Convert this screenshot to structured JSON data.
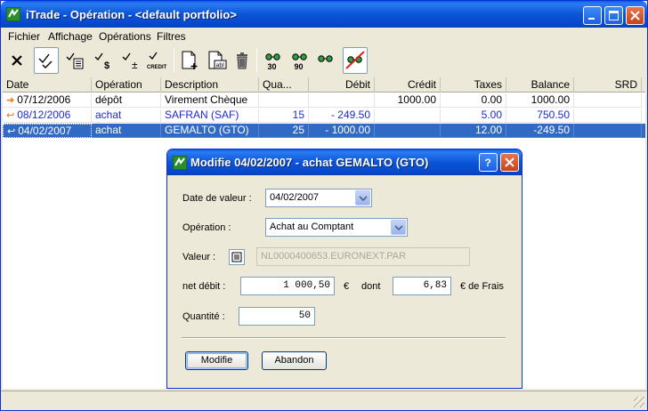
{
  "window": {
    "title": "iTrade - Opération - <default portfolio>"
  },
  "menu": [
    "Fichier",
    "Affichage",
    "Opérations",
    "Filtres"
  ],
  "toolbar": {
    "tools": [
      "close-filter-icon",
      "check-icon",
      "check-list-icon",
      "check-dollar-icon",
      "check-plusminus-icon",
      "check-credit-icon",
      "new-document-icon",
      "edit-document-icon",
      "trash-icon",
      "glasses-30-icon",
      "glasses-90-icon",
      "glasses-icon",
      "glasses-off-icon"
    ],
    "labels": {
      "credit": "CREDIT",
      "d30": "30",
      "d90": "90"
    }
  },
  "table": {
    "columns": [
      "Date",
      "Opération",
      "Description",
      "Qua...",
      "Débit",
      "Crédit",
      "Taxes",
      "Balance",
      "SRD"
    ],
    "rows": [
      {
        "date": "07/12/2006",
        "operation": "dépôt",
        "description": "Virement Chèque",
        "quantity": "",
        "debit": "",
        "credit": "1000.00",
        "taxes": "0.00",
        "balance": "1000.00",
        "srd": ""
      },
      {
        "date": "08/12/2006",
        "operation": "achat",
        "description": "SAFRAN (SAF)",
        "quantity": "15",
        "debit": "- 249.50",
        "credit": "",
        "taxes": "5.00",
        "balance": "750.50",
        "srd": ""
      },
      {
        "date": "04/02/2007",
        "operation": "achat",
        "description": "GEMALTO (GTO)",
        "quantity": "25",
        "debit": "- 1000.00",
        "credit": "",
        "taxes": "12.00",
        "balance": "-249.50",
        "srd": ""
      }
    ]
  },
  "dialog": {
    "title": "Modifie 04/02/2007 - achat GEMALTO (GTO)",
    "date_label": "Date de valeur :",
    "date_value": "04/02/2007",
    "operation_label": "Opération :",
    "operation_value": "Achat au Comptant",
    "valeur_label": "Valeur :",
    "valeur_value": "NL0000400653.EURONEXT.PAR",
    "net_debit_label": "net débit :",
    "net_debit_value": "1 000,50",
    "euro_symbol": "€",
    "dont_label": "dont",
    "frais_value": "6,83",
    "frais_label": "€ de Frais",
    "quantite_label": "Quantité :",
    "quantite_value": "50",
    "modify_button": "Modifie",
    "cancel_button": "Abandon"
  },
  "colors": {
    "titlebar": "#0a55d9",
    "selection": "#316ac5",
    "link_blue": "#1b2bd1",
    "accent_orange": "#e8730c"
  }
}
